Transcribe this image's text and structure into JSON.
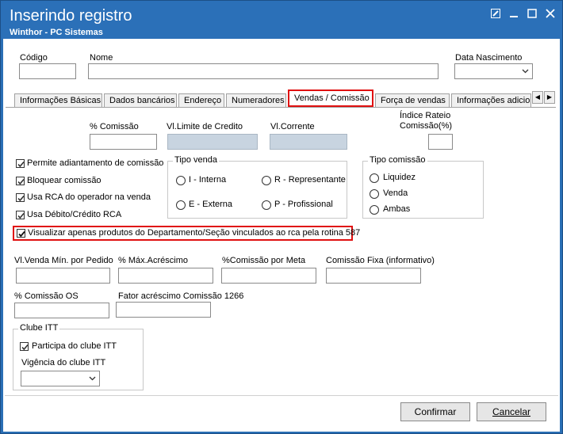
{
  "window": {
    "title": "Inserindo registro",
    "subtitle": "Winthor - PC Sistemas"
  },
  "header": {
    "codigo_label": "Código",
    "nome_label": "Nome",
    "data_nascimento_label": "Data Nascimento",
    "codigo_value": "",
    "nome_value": "",
    "data_nascimento_value": ""
  },
  "tabs": [
    {
      "label": "Informações Básicas"
    },
    {
      "label": "Dados bancários"
    },
    {
      "label": "Endereço"
    },
    {
      "label": "Numeradores"
    },
    {
      "label": "Vendas  / Comissão"
    },
    {
      "label": "Força de vendas"
    },
    {
      "label": "Informações adicio"
    }
  ],
  "commission": {
    "pct_comissao_label": "% Comissão",
    "vl_limite_label": "Vl.Limite de Credito",
    "vl_corrente_label": "Vl.Corrente",
    "indice_rateio_label_1": "Índice Rateio",
    "indice_rateio_label_2": "Comissão(%)"
  },
  "checkboxes": [
    {
      "label": "Permite adiantamento de comissão",
      "checked": true
    },
    {
      "label": "Bloquear comissão",
      "checked": true
    },
    {
      "label": "Usa RCA do operador na venda",
      "checked": true
    },
    {
      "label": "Usa Débito/Crédito RCA",
      "checked": true
    },
    {
      "label": "Visualizar apenas produtos do Departamento/Seção vinculados ao rca pela rotina 587",
      "checked": true
    }
  ],
  "tipo_venda": {
    "title": "Tipo venda",
    "options": [
      "I - Interna",
      "R - Representante",
      "E - Externa",
      "P - Profissional"
    ]
  },
  "tipo_comissao": {
    "title": "Tipo comissão",
    "options": [
      "Liquidez",
      "Venda",
      "Ambas"
    ]
  },
  "row_fields": {
    "vl_venda_min_label": "Vl.Venda Mín. por Pedido",
    "pct_max_acrescimo_label": "% Máx.Acréscimo",
    "pct_comissao_meta_label": "%Comissão por Meta",
    "comissao_fixa_label": "Comissão Fixa (informativo)",
    "pct_comissao_os_label": "% Comissão OS",
    "fator_acrescimo_label": "Fator acréscimo Comissão  1266"
  },
  "clube": {
    "title": "Clube ITT",
    "participa_label": "Participa do clube ITT",
    "participa_checked": true,
    "vigencia_label": "Vigência do clube ITT"
  },
  "buttons": {
    "confirmar": "Confirmar",
    "cancelar": "Cancelar"
  },
  "colors": {
    "titlebar": "#2b70b8",
    "highlight": "#e01010"
  }
}
